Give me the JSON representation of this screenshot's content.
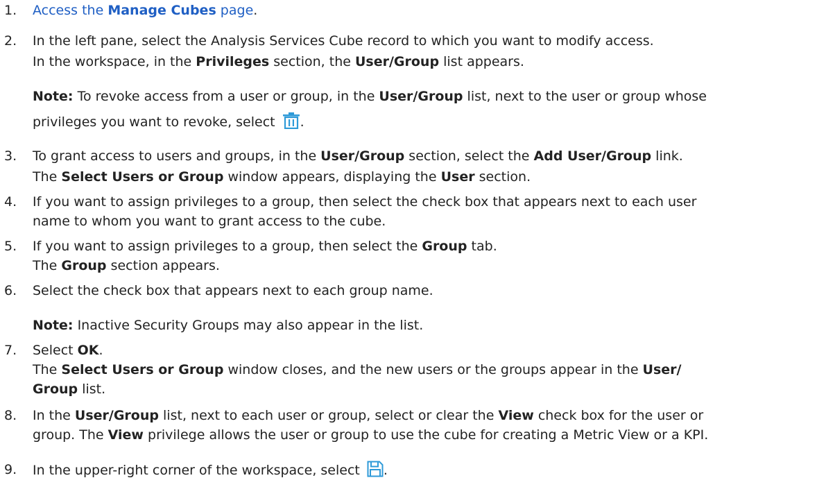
{
  "steps": [
    {
      "num": "1.",
      "link_pre": "Access the ",
      "link_bold": "Manage Cubes",
      "link_post": " page",
      "after": "."
    },
    {
      "num": "2.",
      "line1": "In the left pane, select the Analysis Services Cube record to which you want to modify access.",
      "line2": {
        "a": "In the workspace, in the ",
        "b": "Privileges",
        "c": " section, the ",
        "d": "User/Group",
        "e": " list appears."
      }
    },
    {
      "num": "3.",
      "line1": {
        "a": "To grant access to users and groups, in the ",
        "b": "User/Group",
        "c": " section, select the ",
        "d": "Add User/Group",
        "e": " link."
      },
      "line2": {
        "a": "The ",
        "b": "Select Users or Group",
        "c": " window appears, displaying the ",
        "d": "User",
        "e": " section."
      }
    },
    {
      "num": "4.",
      "line1": "If you want to assign privileges to a group, then select the check box that appears next to each user",
      "line2": "name to whom you want to grant access to the cube."
    },
    {
      "num": "5.",
      "line1": {
        "a": "If you want to assign privileges to a group, then select the ",
        "b": "Group",
        "c": " tab."
      },
      "line2": {
        "a": "The ",
        "b": "Group",
        "c": " section appears."
      }
    },
    {
      "num": "6.",
      "line1": "Select the check box that appears next to each group name."
    },
    {
      "num": "7.",
      "line1": {
        "a": "Select ",
        "b": "OK",
        "c": "."
      },
      "line2": {
        "a": "The ",
        "b": "Select Users or Group",
        "c": " window closes, and the new users or the groups appear in the ",
        "d": "User/"
      },
      "line3": {
        "a": "Group",
        "b": " list."
      }
    },
    {
      "num": "8.",
      "line1": {
        "a": "In the ",
        "b": "User/Group",
        "c": " list, next to each user or group, select or clear the ",
        "d": "View",
        "e": " check box for the user or"
      },
      "line2": {
        "a": "group. The ",
        "b": "View",
        "c": " privilege allows the user or group to use the cube for creating a Metric View or a KPI."
      }
    },
    {
      "num": "9.",
      "line1": "In the upper-right corner of the workspace, select ",
      "after": "."
    }
  ],
  "note1": {
    "label": "Note:",
    "a": " To revoke access from a user or group, in the ",
    "b": "User/Group",
    "c": " list, next to the user or group whose",
    "line2": "privileges you want to revoke, select ",
    "after": "."
  },
  "note2": {
    "label": "Note:",
    "a": " Inactive Security Groups may also appear in the list."
  },
  "icons": {
    "delete": "trash-icon",
    "save": "save-icon"
  },
  "colors": {
    "link": "#1f5fc4",
    "icon": "#2e9ad8"
  }
}
